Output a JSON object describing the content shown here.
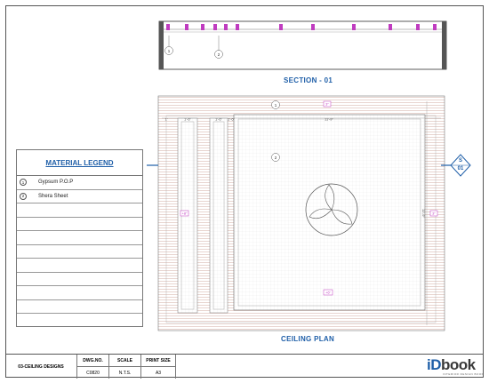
{
  "section_title": "SECTION - 01",
  "plan_title": "CEILING PLAN",
  "legend": {
    "title": "MATERIAL LEGEND",
    "items": [
      {
        "num": "1",
        "label": "Gypsum P.O.P"
      },
      {
        "num": "2",
        "label": "Shera Sheet"
      }
    ]
  },
  "section_marker": {
    "top": "S",
    "bottom": "01"
  },
  "plan_tags": {
    "tag1": "1",
    "tag2": "2",
    "sec_tag1": "1",
    "sec_tag2": "2",
    "top_level": "3\"",
    "left_level": "+8\"",
    "right_level": "3\"",
    "bottom_level": "+6\"",
    "dim_top": "11'-9\"",
    "dim_right": "11'-9\"",
    "dim_small_1": "1'",
    "dim_small_2": "1'-6\"",
    "dim_small_3": "1'-6\"",
    "dim_small_4": "1'-6\""
  },
  "title_block": {
    "drawing_name": "03-CEILING DESIGNS",
    "dwg_no_label": "DWG.NO.",
    "dwg_no": "C0820",
    "scale_label": "SCALE",
    "scale": "N.T.S.",
    "print_label": "PRINT SIZE",
    "print": "A3"
  },
  "logo": {
    "prefix": "iD",
    "name": "book",
    "tagline": "INTERIOR DESIGN BOOK"
  },
  "colors": {
    "accent": "#1f5fa8",
    "magenta": "#c03cc0",
    "hatch": "#c8aaa0"
  }
}
